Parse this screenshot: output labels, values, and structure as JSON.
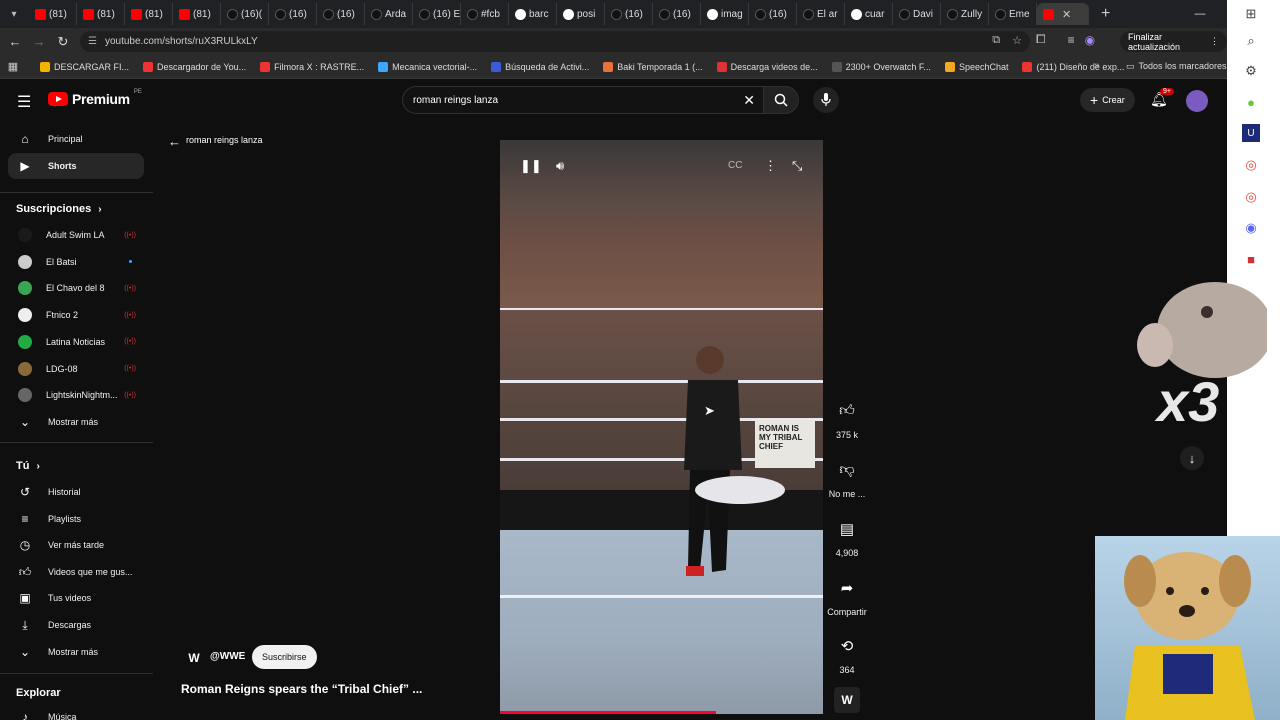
{
  "tabs": {
    "items": [
      {
        "label": "(81)",
        "kind": "yt"
      },
      {
        "label": "(81)",
        "kind": "yt"
      },
      {
        "label": "(81)",
        "kind": "yt"
      },
      {
        "label": "(81)",
        "kind": "yt"
      },
      {
        "label": "(16)(",
        "kind": "tk"
      },
      {
        "label": "(16)",
        "kind": "tk"
      },
      {
        "label": "(16)",
        "kind": "tk"
      },
      {
        "label": "Arda",
        "kind": "tk"
      },
      {
        "label": "(16) E",
        "kind": "tk"
      },
      {
        "label": "#fcb",
        "kind": "tk"
      },
      {
        "label": "barc",
        "kind": "gg"
      },
      {
        "label": "posi",
        "kind": "gg"
      },
      {
        "label": "(16)",
        "kind": "tk"
      },
      {
        "label": "(16)",
        "kind": "tk"
      },
      {
        "label": "imag",
        "kind": "gg"
      },
      {
        "label": "(16)",
        "kind": "tk"
      },
      {
        "label": "El ar",
        "kind": "tk"
      },
      {
        "label": "cuar",
        "kind": "gg"
      },
      {
        "label": "Davi",
        "kind": "tk"
      },
      {
        "label": "Zully",
        "kind": "tk"
      },
      {
        "label": "Eme",
        "kind": "tk"
      },
      {
        "label": "",
        "kind": "yt",
        "active": true
      }
    ]
  },
  "address": {
    "url": "youtube.com/shorts/ruX3RULkxLY",
    "update_label": "Finalizar actualización"
  },
  "bookmarks": {
    "items": [
      "DESCARGAR FI...",
      "Descargador de You...",
      "Filmora X : RASTRE...",
      "Mecanica vectorial-...",
      "Búsqueda de Activi...",
      "Baki Temporada 1 (...",
      "Descarga videos de...",
      "2300+ Overwatch F...",
      "SpeechChat",
      "(211) Diseño de exp..."
    ],
    "all_label": "Todos los marcadores"
  },
  "header": {
    "logo": "Premium",
    "country": "PE",
    "search_value": "roman reings lanza",
    "create_label": "Crear",
    "notif_count": "9+"
  },
  "sidebar": {
    "main": [
      "Principal",
      "Shorts"
    ],
    "subs_title": "Suscripciones",
    "subs": [
      "Adult Swim LA",
      "El Batsi",
      "El Chavo del 8",
      "Ftnico 2",
      "Latina Noticias",
      "LDG-08",
      "LightskinNightm..."
    ],
    "subs_more": "Mostrar más",
    "you_title": "Tú",
    "you": [
      "Historial",
      "Playlists",
      "Ver más tarde",
      "Videos que me gus...",
      "Tus videos",
      "Descargas"
    ],
    "you_more": "Mostrar más",
    "explore_title": "Explorar",
    "explore": [
      "Música"
    ]
  },
  "main": {
    "query_label": "roman reings lanza",
    "channel": "@WWE",
    "subscribe": "Suscribirse",
    "title": "Roman Reigns spears the “Tribal Chief” ...",
    "likes": "375 k",
    "dislike_label": "No me ...",
    "comments": "4,908",
    "share_label": "Compartir",
    "remix": "364",
    "progress_fraction": 0.67,
    "sign_text": "ROMAN IS MY TRIBAL CHIEF"
  },
  "overlay": {
    "text": "x3"
  }
}
